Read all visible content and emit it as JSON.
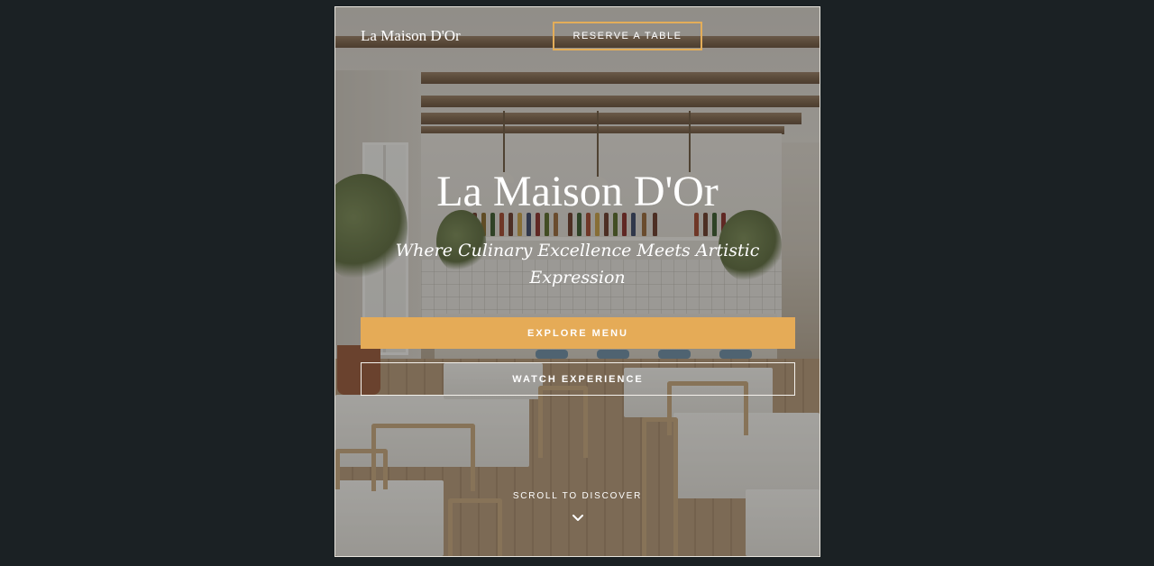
{
  "header": {
    "brand": "La Maison D'Or",
    "reserve_label": "RESERVE A TABLE"
  },
  "hero": {
    "title": "La Maison D'Or",
    "tagline": "Where Culinary Excellence Meets Artistic Expression",
    "explore_label": "EXPLORE MENU",
    "watch_label": "WATCH EXPERIENCE",
    "scroll_label": "SCROLL TO DISCOVER",
    "scroll_icon": "chevron-down-icon"
  },
  "colors": {
    "accent": "#e5ab57",
    "reserve_border": "#e3ad59",
    "page_background": "#1b2124",
    "text": "#ffffff"
  }
}
